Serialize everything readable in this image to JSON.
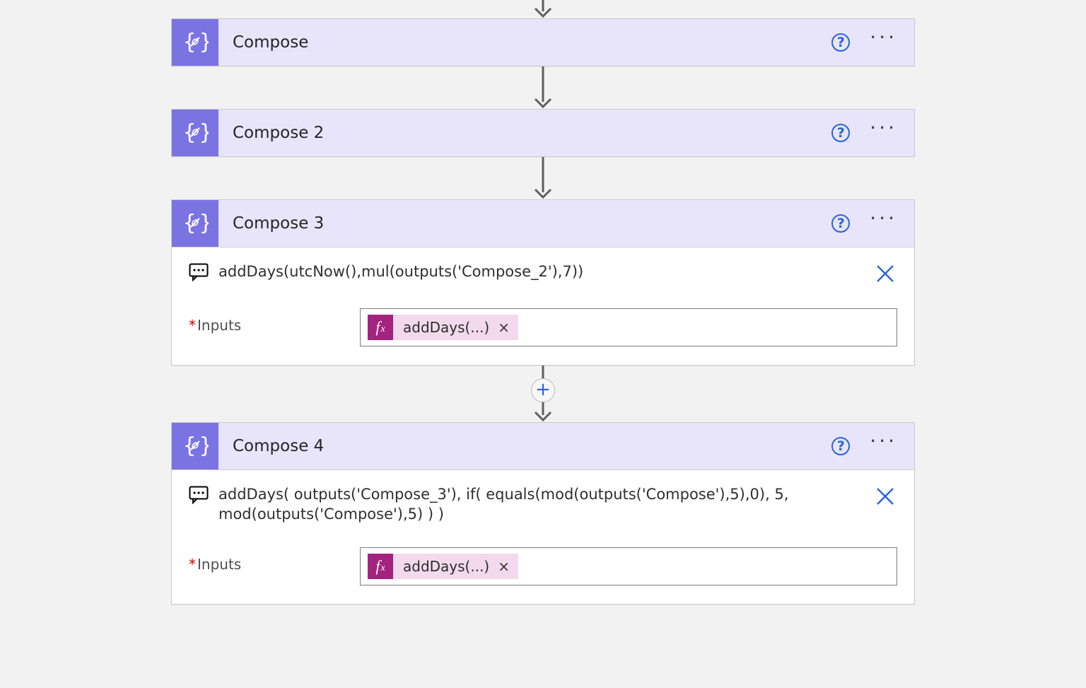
{
  "actions": [
    {
      "id": "compose1",
      "title": "Compose",
      "expanded": false
    },
    {
      "id": "compose2",
      "title": "Compose 2",
      "expanded": false
    },
    {
      "id": "compose3",
      "title": "Compose 3",
      "expanded": true,
      "peek": "addDays(utcNow(),mul(outputs('Compose_2'),7))",
      "inputs_label": "Inputs",
      "chip": "addDays(...)"
    },
    {
      "id": "compose4",
      "title": "Compose 4",
      "expanded": true,
      "peek": "addDays( outputs('Compose_3'), if( equals(mod(outputs('Compose'),5),0), 5, mod(outputs('Compose'),5) ) )",
      "inputs_label": "Inputs",
      "chip": "addDays(...)"
    }
  ],
  "connectors": [
    {
      "plus": false,
      "height": "short"
    },
    {
      "plus": false,
      "height": "normal"
    },
    {
      "plus": false,
      "height": "normal"
    },
    {
      "plus": true,
      "height": "tall"
    }
  ],
  "glyphs": {
    "help": "?",
    "more": "···",
    "plus": "+",
    "chip_x": "×"
  }
}
